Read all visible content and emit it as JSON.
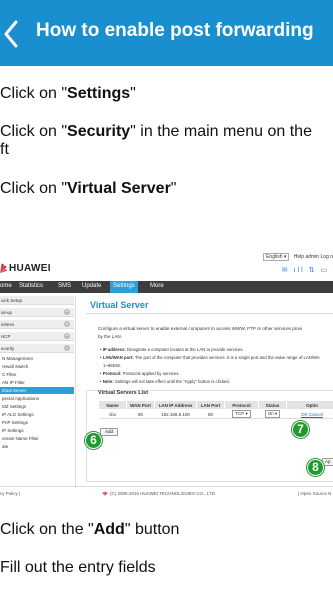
{
  "header": {
    "title": "How to enable post forwarding"
  },
  "steps": [
    {
      "before": "Click on \"",
      "bold": "Settings",
      "after": "\""
    },
    {
      "before": "Click on \"",
      "bold": "Security",
      "after": "\" in the main menu on the"
    },
    {
      "line2": "ft"
    },
    {
      "before": "Click on \"",
      "bold": "Virtual Server",
      "after": "\""
    },
    {
      "before": "Click on the \"",
      "bold": "Add",
      "after": "\" button"
    },
    {
      "text": "Fill out the entry fields"
    }
  ],
  "screenshot": {
    "brand": "HUAWEI",
    "top_links": {
      "language": "English ▾",
      "help": "Help",
      "admin": "admin",
      "logout": "Log o"
    },
    "status_icons": "✉ ıll ⇅ ▭",
    "nav": [
      "ome",
      "Statistics",
      "SMS",
      "Update",
      "Settings",
      "More"
    ],
    "nav_active": "Settings",
    "sidebar_heads": [
      "uick Setup",
      "ial-up",
      "ireless",
      "HCP",
      "ecurity"
    ],
    "sidebar_items": [
      "N Management",
      "rewall Switch",
      "C Filter",
      "AN IP Filter",
      "irtual Server",
      "pecial Applications",
      "MZ Settings",
      "IP ALG Settings",
      "PnP Settings",
      "IP Settings",
      "omain Name Filter",
      "ate"
    ],
    "sidebar_active": "irtual Server",
    "content": {
      "title": "Virtual Server",
      "description": "Configure a virtual server to enable external computers to access WWW, FTP or other services provi",
      "description2": "by the LAN.",
      "bullets": [
        {
          "label": "IP address:",
          "text": " Designate a computer locates at the LAN to provide services."
        },
        {
          "label": "LAN/WAN port:",
          "text": " The port of the computer that provides services. It is a single port and the value range of LAN/WA"
        },
        {
          "label": "",
          "text": "1~65535."
        },
        {
          "label": "Protocol:",
          "text": " Protocols applied by services."
        },
        {
          "label": "Note:",
          "text": " Settings will not take effect until the \"Apply\" button is clicked."
        }
      ],
      "list_title": "Virtual Servers List",
      "table_headers": [
        "Name",
        "WAN Port",
        "LAN IP Address",
        "LAN Port",
        "Protocol",
        "Status",
        "Optio"
      ],
      "table_row": [
        "cbx",
        "80",
        "192.168.8.100",
        "80",
        "TCP ▾",
        "On ▾",
        "OK  Cancel"
      ],
      "add_button": "Add",
      "apply_button": "Ap"
    },
    "markers": [
      "6",
      "7",
      "8"
    ],
    "footer": {
      "left": "cy Policy |",
      "center": "(C) 2006-2016 HUAWEI TECHNOLOGIES CO., LTD.",
      "right": "| Open Source N"
    }
  },
  "colors": {
    "header_bg": "#1a8fcf",
    "marker_green": "#1e9a2f",
    "nav_bg": "#3d3d3d",
    "nav_active": "#2a9fd8"
  }
}
